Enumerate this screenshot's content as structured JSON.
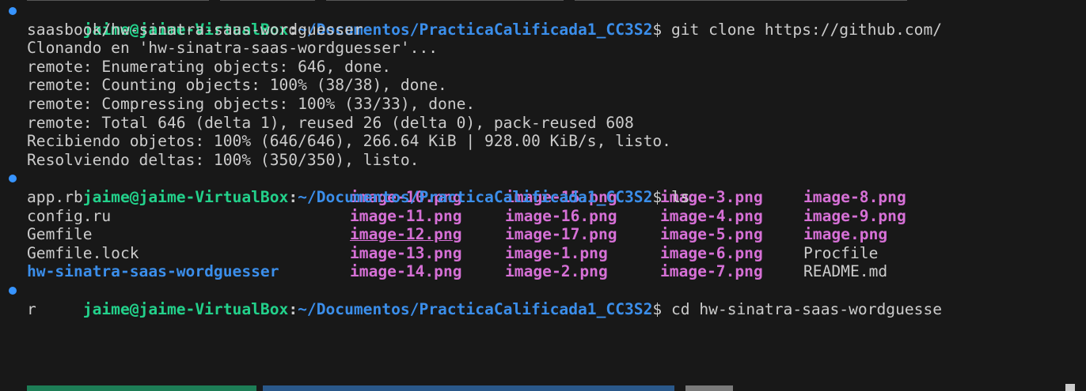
{
  "prompt": {
    "user_host": "jaime@jaime-VirtualBox",
    "colon": ":",
    "path": "~/Documentos/PracticaCalificada1_CC3S2",
    "symbol": "$"
  },
  "block1": {
    "command": " git clone https://github.com/",
    "command_wrap": "saasbook/hw-sinatra-saas-wordguesser",
    "output": [
      "Clonando en 'hw-sinatra-saas-wordguesser'...",
      "remote: Enumerating objects: 646, done.",
      "remote: Counting objects: 100% (38/38), done.",
      "remote: Compressing objects: 100% (33/33), done.",
      "remote: Total 646 (delta 1), reused 26 (delta 0), pack-reused 608",
      "Recibiendo objetos: 100% (646/646), 266.64 KiB | 928.00 KiB/s, listo.",
      "Resolviendo deltas: 100% (350/350), listo."
    ]
  },
  "block2": {
    "command": " ls",
    "rows": [
      [
        "app.rb",
        "image-10.png",
        "image-15.png",
        "image-3.png",
        "image-8.png"
      ],
      [
        "config.ru",
        "image-11.png",
        "image-16.png",
        "image-4.png",
        "image-9.png"
      ],
      [
        "Gemfile",
        "image-12.png",
        "image-17.png",
        "image-5.png",
        "image.png"
      ],
      [
        "Gemfile.lock",
        "image-13.png",
        "image-1.png",
        "image-6.png",
        "Procfile"
      ],
      [
        "hw-sinatra-saas-wordguesser",
        "image-14.png",
        "image-2.png",
        "image-7.png",
        "README.md"
      ]
    ]
  },
  "block3": {
    "command": " cd hw-sinatra-saas-wordguesse",
    "command_wrap": "r"
  },
  "colors": {
    "background": "#181818",
    "user": "#23d18b",
    "path": "#3b8eea",
    "image_files": "#d670d6",
    "text": "#cccccc",
    "dot": "#3794ff"
  }
}
